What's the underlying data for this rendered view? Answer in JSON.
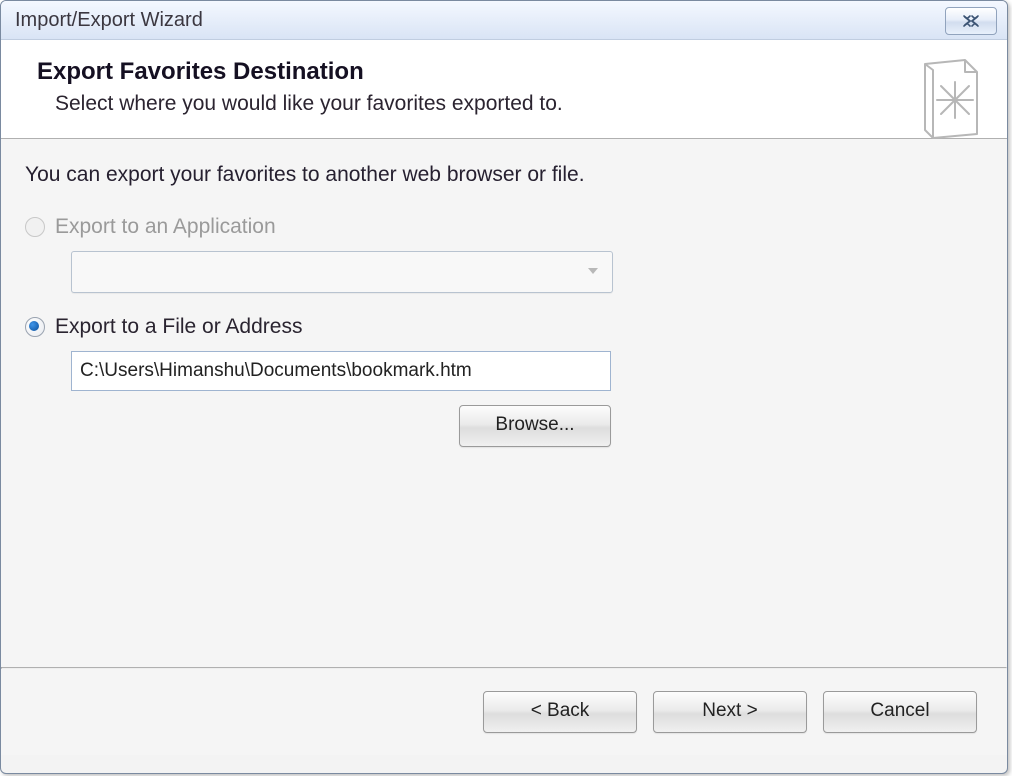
{
  "window": {
    "title": "Import/Export Wizard"
  },
  "header": {
    "heading": "Export Favorites Destination",
    "subtitle": "Select where you would like your favorites exported to."
  },
  "body": {
    "intro": "You can export your favorites to another web browser or file.",
    "option_app": {
      "label": "Export to an Application",
      "enabled": false,
      "checked": false,
      "combo_value": ""
    },
    "option_file": {
      "label": "Export to a File or Address",
      "enabled": true,
      "checked": true,
      "path": "C:\\Users\\Himanshu\\Documents\\bookmark.htm"
    },
    "browse_label": "Browse..."
  },
  "footer": {
    "back": "< Back",
    "next": "Next >",
    "cancel": "Cancel"
  }
}
